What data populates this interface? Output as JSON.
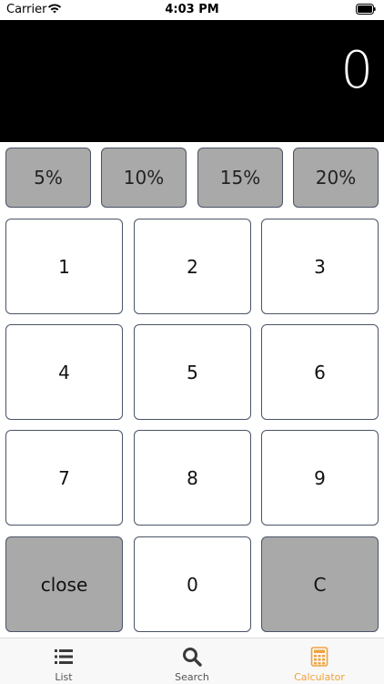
{
  "status_bar": {
    "carrier": "Carrier",
    "time": "4:03 PM"
  },
  "display": {
    "value": "0"
  },
  "tips": [
    {
      "label": "5%"
    },
    {
      "label": "10%"
    },
    {
      "label": "15%"
    },
    {
      "label": "20%"
    }
  ],
  "keypad": {
    "k1": "1",
    "k2": "2",
    "k3": "3",
    "k4": "4",
    "k5": "5",
    "k6": "6",
    "k7": "7",
    "k8": "8",
    "k9": "9",
    "close": "close",
    "k0": "0",
    "clear": "C"
  },
  "tab_bar": {
    "items": [
      {
        "label": "List",
        "icon": "list-icon"
      },
      {
        "label": "Search",
        "icon": "search-icon"
      },
      {
        "label": "Calculator",
        "icon": "calculator-icon"
      }
    ],
    "active_color": "#f0a23c"
  }
}
